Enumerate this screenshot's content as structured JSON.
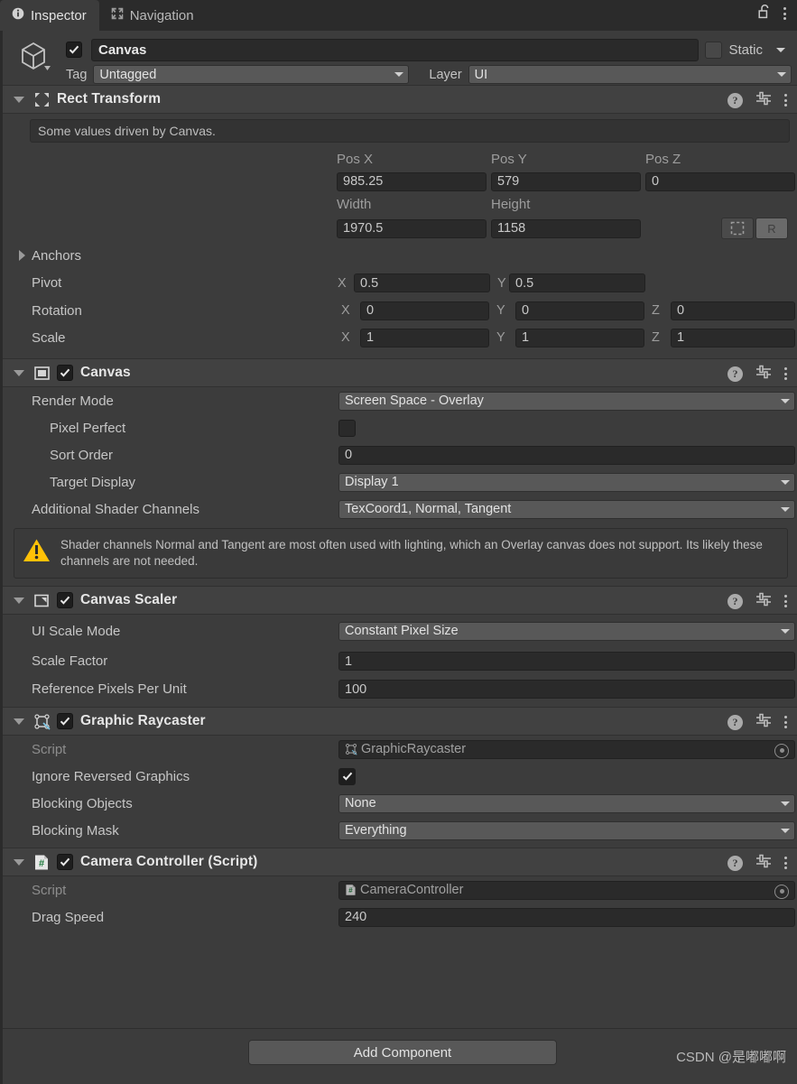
{
  "window": {
    "tabs": [
      {
        "label": "Inspector",
        "icon": "info-icon",
        "active": true
      },
      {
        "label": "Navigation",
        "icon": "navigation-expand-icon",
        "active": false
      }
    ],
    "lock_icon": "padlock-unlocked-icon",
    "menu_icon": "kebab-menu-icon"
  },
  "object_header": {
    "icon": "gameobject-cube-icon",
    "enabled": true,
    "name": "Canvas",
    "static_label": "Static",
    "static_checked": false,
    "tag_label": "Tag",
    "tag_value": "Untagged",
    "layer_label": "Layer",
    "layer_value": "UI"
  },
  "components": [
    {
      "id": "rect-transform",
      "title": "Rect Transform",
      "icon": "rect-transform-icon",
      "has_enable_checkbox": false,
      "expanded": true,
      "info_text": "Some values driven by Canvas.",
      "col_headers_1": [
        "Pos X",
        "Pos Y",
        "Pos Z"
      ],
      "col_values_1": [
        "985.25",
        "579",
        "0"
      ],
      "col_headers_2": [
        "Width",
        "Height"
      ],
      "col_values_2": [
        "1970.5",
        "1158"
      ],
      "anchor_buttons": [
        {
          "name": "anchor-preset-button",
          "label": ""
        },
        {
          "name": "anchor-r-button",
          "label": "R"
        }
      ],
      "anchors_label": "Anchors",
      "pivot_label": "Pivot",
      "pivot": {
        "x_axis": "X",
        "x": "0.5",
        "y_axis": "Y",
        "y": "0.5"
      },
      "rotation_label": "Rotation",
      "rotation": {
        "x_axis": "X",
        "x": "0",
        "y_axis": "Y",
        "y": "0",
        "z_axis": "Z",
        "z": "0"
      },
      "scale_label": "Scale",
      "scale": {
        "x_axis": "X",
        "x": "1",
        "y_axis": "Y",
        "y": "1",
        "z_axis": "Z",
        "z": "1"
      }
    },
    {
      "id": "canvas",
      "title": "Canvas",
      "icon": "canvas-icon",
      "has_enable_checkbox": true,
      "enabled": true,
      "expanded": true,
      "fields": [
        {
          "label": "Render Mode",
          "type": "dropdown",
          "value": "Screen Space - Overlay",
          "indent": 0
        },
        {
          "label": "Pixel Perfect",
          "type": "checkbox",
          "value": false,
          "indent": 1
        },
        {
          "label": "Sort Order",
          "type": "text",
          "value": "0",
          "indent": 1
        },
        {
          "label": "Target Display",
          "type": "dropdown",
          "value": "Display 1",
          "indent": 1
        },
        {
          "label": "Additional Shader Channels",
          "type": "dropdown",
          "value": "TexCoord1, Normal, Tangent",
          "indent": 0
        }
      ],
      "warning": {
        "icon": "warning-triangle-icon",
        "text": "Shader channels Normal and Tangent are most often used with lighting, which an Overlay canvas does not support. Its likely these channels are not needed."
      }
    },
    {
      "id": "canvas-scaler",
      "title": "Canvas Scaler",
      "icon": "canvas-scaler-icon",
      "has_enable_checkbox": true,
      "enabled": true,
      "expanded": true,
      "fields": [
        {
          "label": "UI Scale Mode",
          "type": "dropdown",
          "value": "Constant Pixel Size",
          "indent": 0
        },
        {
          "label": "Scale Factor",
          "type": "text",
          "value": "1",
          "indent": 0
        },
        {
          "label": "Reference Pixels Per Unit",
          "type": "text",
          "value": "100",
          "indent": 0
        }
      ]
    },
    {
      "id": "graphic-raycaster",
      "title": "Graphic Raycaster",
      "icon": "graphic-raycaster-icon",
      "has_enable_checkbox": true,
      "enabled": true,
      "expanded": true,
      "fields": [
        {
          "label": "Script",
          "type": "object",
          "value": "GraphicRaycaster",
          "value_icon": "graphic-raycaster-icon",
          "indent": 0,
          "disabled": true
        },
        {
          "label": "Ignore Reversed Graphics",
          "type": "checkbox",
          "value": true,
          "indent": 0
        },
        {
          "label": "Blocking Objects",
          "type": "dropdown",
          "value": "None",
          "indent": 0
        },
        {
          "label": "Blocking Mask",
          "type": "dropdown",
          "value": "Everything",
          "indent": 0
        }
      ]
    },
    {
      "id": "camera-controller",
      "title": "Camera Controller (Script)",
      "icon": "csharp-script-icon",
      "has_enable_checkbox": true,
      "enabled": true,
      "expanded": true,
      "fields": [
        {
          "label": "Script",
          "type": "object",
          "value": "CameraController",
          "value_icon": "csharp-script-icon",
          "indent": 0,
          "disabled": true
        },
        {
          "label": "Drag Speed",
          "type": "text",
          "value": "240",
          "indent": 0
        }
      ]
    }
  ],
  "component_head_icons": {
    "help": "help-icon",
    "preset": "preset-settings-icon",
    "menu": "kebab-menu-icon"
  },
  "footer": {
    "add_component_label": "Add Component",
    "watermark": "CSDN @是嘟嘟啊"
  },
  "colors": {
    "panel_bg": "#3c3c3c",
    "header_bg": "#414141",
    "tabbar_bg": "#2b2b2b",
    "input_bg": "#2a2a2a",
    "dropdown_bg": "#585858",
    "warning": "#ffc107",
    "text": "#c6c6c6"
  }
}
